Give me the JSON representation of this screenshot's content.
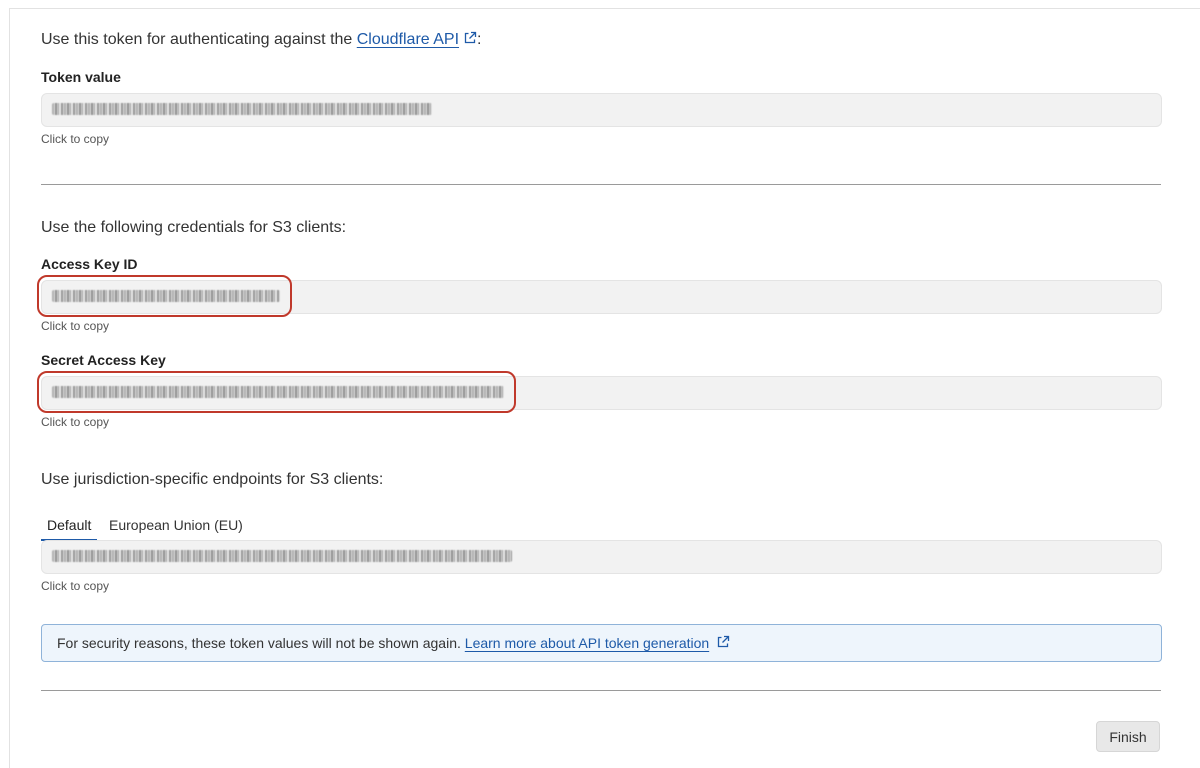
{
  "token_section": {
    "intro_text": "Use this token for authenticating against the ",
    "link_text": "Cloudflare API",
    "intro_suffix": ":",
    "token_label": "Token value",
    "copy_hint": "Click to copy"
  },
  "s3_section": {
    "intro_text": "Use the following credentials for S3 clients:",
    "access_key_label": "Access Key ID",
    "access_key_hint": "Click to copy",
    "secret_key_label": "Secret Access Key",
    "secret_key_hint": "Click to copy"
  },
  "endpoints_section": {
    "intro_text": "Use jurisdiction-specific endpoints for S3 clients:",
    "tabs": [
      {
        "label": "Default",
        "active": true
      },
      {
        "label": "European Union (EU)",
        "active": false
      }
    ],
    "copy_hint": "Click to copy"
  },
  "notice": {
    "text": "For security reasons, these token values will not be shown again. ",
    "link_text": "Learn more about API token generation"
  },
  "footer": {
    "finish_label": "Finish"
  },
  "colors": {
    "link": "#1e5aa8",
    "highlight": "#c0392b",
    "notice_bg": "#eef5fc",
    "notice_border": "#8fb3d9"
  },
  "icons": [
    "external-link-icon"
  ]
}
